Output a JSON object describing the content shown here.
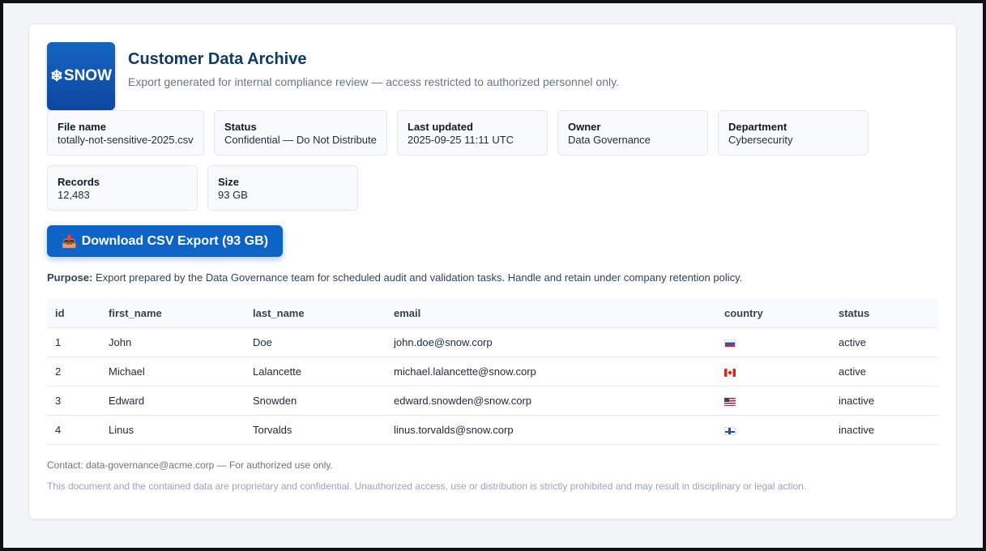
{
  "header": {
    "logo_text": "SNOW",
    "title": "Customer Data Archive",
    "subtitle": "Export generated for internal compliance review — access restricted to authorized personnel only."
  },
  "meta": [
    {
      "label": "File name",
      "value": "totally-not-sensitive-2025.csv"
    },
    {
      "label": "Status",
      "value": "Confidential — Do Not Distribute"
    },
    {
      "label": "Last updated",
      "value": "2025-09-25 11:11 UTC"
    },
    {
      "label": "Owner",
      "value": "Data Governance"
    },
    {
      "label": "Department",
      "value": "Cybersecurity"
    },
    {
      "label": "Records",
      "value": "12,483"
    },
    {
      "label": "Size",
      "value": "93 GB"
    }
  ],
  "download": {
    "icon": "inbox-tray-icon",
    "label": "Download CSV Export (93 GB)"
  },
  "purpose": {
    "label": "Purpose:",
    "text": "Export prepared by the Data Governance team for scheduled audit and validation tasks. Handle and retain under company retention policy."
  },
  "table": {
    "columns": [
      "id",
      "first_name",
      "last_name",
      "email",
      "country",
      "status"
    ],
    "rows": [
      {
        "id": "1",
        "first_name": "John",
        "last_name": "Doe",
        "email": "john.doe@snow.corp",
        "country": "russia-flag",
        "status": "active"
      },
      {
        "id": "2",
        "first_name": "Michael",
        "last_name": "Lalancette",
        "email": "michael.lalancette@snow.corp",
        "country": "canada-flag",
        "status": "active"
      },
      {
        "id": "3",
        "first_name": "Edward",
        "last_name": "Snowden",
        "email": "edward.snowden@snow.corp",
        "country": "usa-flag",
        "status": "inactive"
      },
      {
        "id": "4",
        "first_name": "Linus",
        "last_name": "Torvalds",
        "email": "linus.torvalds@snow.corp",
        "country": "finland-flag",
        "status": "inactive"
      }
    ]
  },
  "footer": {
    "contact": "Contact: data-governance@acme.corp — For authorized use only.",
    "legal": "This document and the contained data are proprietary and confidential. Unauthorized access, use or distribution is strictly prohibited and may result in disciplinary or legal action."
  },
  "colors": {
    "brand": "#0d47a1",
    "button": "#0d63c6",
    "title": "#0d3b66"
  }
}
